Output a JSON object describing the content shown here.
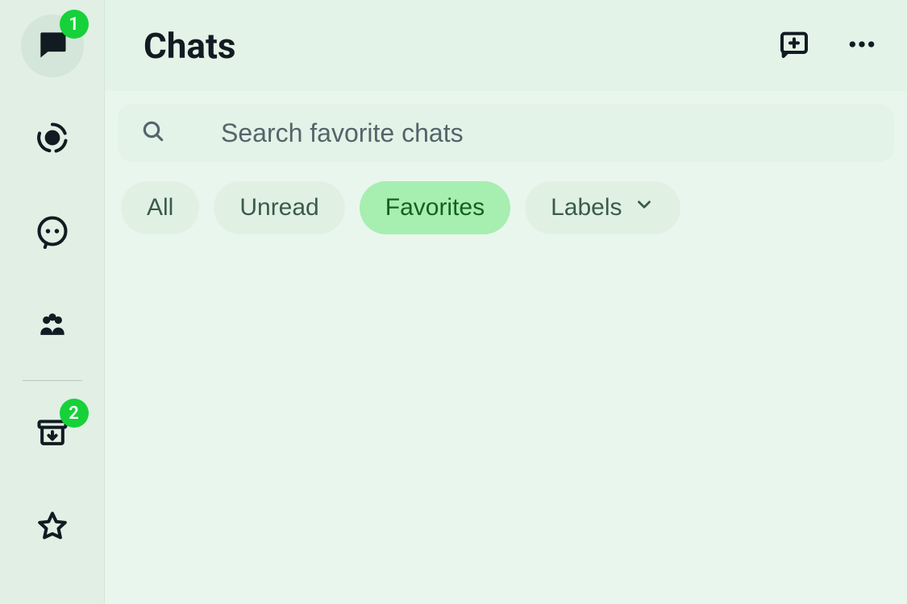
{
  "sidebar": {
    "items": [
      {
        "name": "chats",
        "icon": "chat-icon",
        "active": true,
        "badge": "1"
      },
      {
        "name": "status",
        "icon": "status-icon",
        "active": false,
        "badge": null
      },
      {
        "name": "channels",
        "icon": "channels-icon",
        "active": false,
        "badge": null
      },
      {
        "name": "communities",
        "icon": "communities-icon",
        "active": false,
        "badge": null
      }
    ],
    "afterDivider": [
      {
        "name": "archived",
        "icon": "archive-icon",
        "active": false,
        "badge": "2"
      },
      {
        "name": "starred",
        "icon": "star-icon",
        "active": false,
        "badge": null
      }
    ]
  },
  "header": {
    "title": "Chats"
  },
  "search": {
    "placeholder": "Search favorite chats"
  },
  "filters": {
    "all": "All",
    "unread": "Unread",
    "favorites": "Favorites",
    "labels": "Labels",
    "selected": "favorites"
  },
  "colors": {
    "background": "#e9f6ed",
    "sidebarBg": "#e1efe5",
    "chipBg": "#e0f1e4",
    "chipSelectedBg": "#a7eeb1",
    "badgeBg": "#16d13a"
  }
}
